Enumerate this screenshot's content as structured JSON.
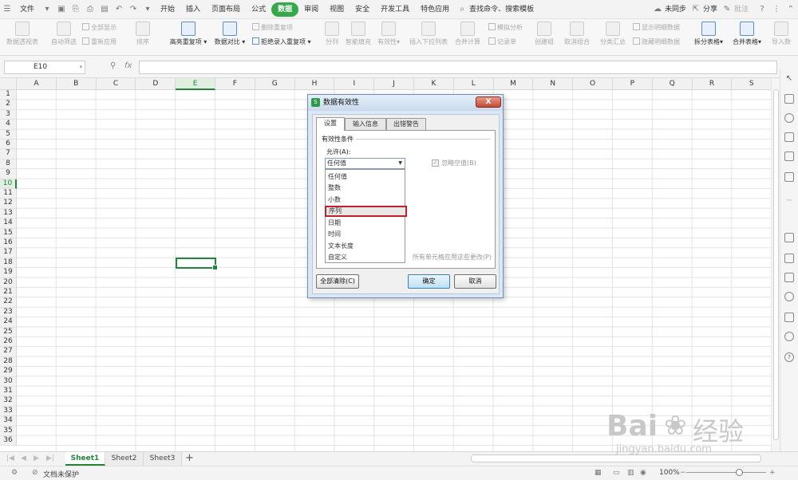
{
  "menubar": {
    "file_label": "文件",
    "tabs": [
      "开始",
      "插入",
      "页面布局",
      "公式",
      "数据",
      "审阅",
      "视图",
      "安全",
      "开发工具",
      "特色应用"
    ],
    "active_tab": "数据",
    "search_label": "查找命令、搜索模板",
    "sync_label": "未同步",
    "share_label": "分享",
    "comment_label": "批注"
  },
  "ribbon": {
    "pivot": "数据透视表",
    "autofilter": "自动筛选",
    "show_all": "全部显示",
    "reapply": "重新应用",
    "sort": "排序",
    "highlight_dup": "高亮重复项",
    "data_compare": "数据对比",
    "remove_dup": "删除重复项",
    "reject_dup": "拒绝录入重复项",
    "split": "分列",
    "smart_fill": "智能填充",
    "validity": "有效性",
    "insert_dropdown": "插入下拉列表",
    "consolidate": "合并计算",
    "simulate": "模拟分析",
    "record": "记录单",
    "group": "创建组",
    "ungroup": "取消组合",
    "subtotal": "分类汇总",
    "show_detail": "显示明细数据",
    "hide_detail": "隐藏明细数据",
    "split_table": "拆分表格",
    "merge_table": "合并表格",
    "import": "导入数"
  },
  "formula_bar": {
    "cell_ref": "E10",
    "fx": "fx"
  },
  "grid": {
    "columns": [
      "A",
      "B",
      "C",
      "D",
      "E",
      "F",
      "G",
      "H",
      "I",
      "J",
      "K",
      "L",
      "M",
      "N",
      "O",
      "P",
      "Q",
      "R",
      "S"
    ],
    "rows": [
      "1",
      "2",
      "3",
      "4",
      "5",
      "6",
      "7",
      "8",
      "9",
      "10",
      "11",
      "12",
      "13",
      "14",
      "15",
      "16",
      "17",
      "18",
      "19",
      "20",
      "21",
      "22",
      "23",
      "24",
      "25",
      "26",
      "27",
      "28",
      "29",
      "30",
      "31",
      "32",
      "33",
      "34",
      "35",
      "36"
    ],
    "selected_col": "E",
    "selected_row": "10"
  },
  "sheets": [
    "Sheet1",
    "Sheet2",
    "Sheet3"
  ],
  "active_sheet": "Sheet1",
  "add_sheet": "+",
  "status": {
    "doc_protect": "文档未保护",
    "zoom": "100%"
  },
  "dialog": {
    "title": "数据有效性",
    "close": "X",
    "tabs": [
      "设置",
      "输入信息",
      "出错警告"
    ],
    "section": "有效性条件",
    "allow_label": "允许(A):",
    "selected_value": "任何值",
    "options": [
      "任何值",
      "整数",
      "小数",
      "序列",
      "日期",
      "时间",
      "文本长度",
      "自定义"
    ],
    "highlighted_option": "序列",
    "ignore_blank": "忽略空值(B)",
    "apply_all_partial": "所有单元格应用这些更改(P)",
    "clear_all": "全部清除(C)",
    "ok": "确定",
    "cancel": "取消"
  },
  "watermark": {
    "brand": "Bai",
    "brand_cn": "经验",
    "url": "jingyan.baidu.com"
  }
}
